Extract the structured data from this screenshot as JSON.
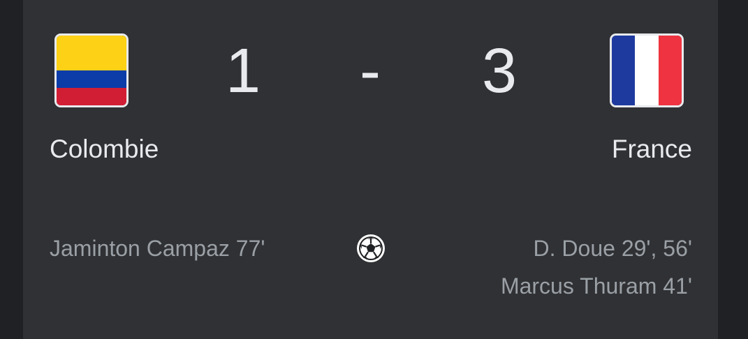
{
  "match": {
    "home": {
      "name": "Colombie",
      "score": "1",
      "flag_icon": "colombia-flag-icon",
      "scorers": [
        "Jaminton Campaz 77'"
      ]
    },
    "away": {
      "name": "France",
      "score": "3",
      "flag_icon": "france-flag-icon",
      "scorers": [
        "D. Doue 29', 56'",
        "Marcus Thuram 41'"
      ]
    },
    "separator": "-",
    "goal_icon": "soccer-ball-icon"
  },
  "colors": {
    "background": "#202124",
    "card": "#303134",
    "primary_text": "#e8eaed",
    "secondary_text": "#9aa0a6"
  }
}
